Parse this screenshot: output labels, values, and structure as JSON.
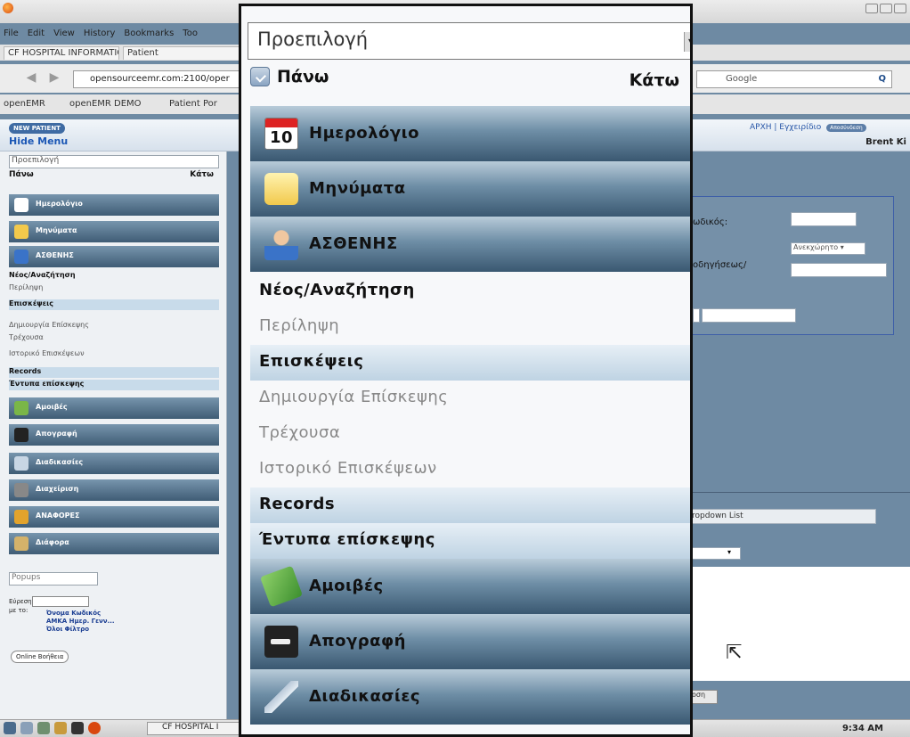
{
  "browser": {
    "menu": [
      "File",
      "Edit",
      "View",
      "History",
      "Bookmarks",
      "Too"
    ],
    "tabs": [
      "CF HOSPITAL INFORMATION... ✕",
      "Patient"
    ],
    "url": "opensourceemr.com:2100/oper",
    "search_placeholder": "Google",
    "bookmarks": [
      "openEMR",
      "openEMR DEMO",
      "Patient Por"
    ]
  },
  "header": {
    "new_patient": "NEW PATIENT",
    "hide_menu": "Hide Menu",
    "top_links": "ΑΡΧΗ | Εγχειρίδιο",
    "logout": "Αποσύνδεση",
    "user": "Brent Ki"
  },
  "left_small": {
    "select": "Προεπιλογή",
    "up": "Πάνω",
    "down": "Κάτω",
    "items": [
      {
        "type": "bar",
        "label": "Ημερολόγιο",
        "icon": "calendar-icon"
      },
      {
        "type": "bar",
        "label": "Μηνύματα",
        "icon": "mail-icon"
      },
      {
        "type": "bar",
        "label": "ΑΣΘΕΝΗΣ",
        "icon": "patient-icon"
      },
      {
        "type": "dark",
        "label": "Νέος/Αναζήτηση"
      },
      {
        "type": "text",
        "label": "Περίληψη"
      },
      {
        "type": "sec",
        "label": "Επισκέψεις"
      },
      {
        "type": "text",
        "label": "Δημιουργία Επίσκεψης"
      },
      {
        "type": "text",
        "label": "Τρέχουσα"
      },
      {
        "type": "text",
        "label": "Ιστορικό Επισκέψεων"
      },
      {
        "type": "sec",
        "label": "Records"
      },
      {
        "type": "sec",
        "label": "Έντυπα επίσκεψης"
      },
      {
        "type": "bar",
        "label": "Αμοιβές",
        "icon": "money-icon"
      },
      {
        "type": "bar",
        "label": "Απογραφή",
        "icon": "key-icon"
      },
      {
        "type": "bar",
        "label": "Διαδικασίες",
        "icon": "syringe-icon"
      },
      {
        "type": "bar",
        "label": "Διαχείριση",
        "icon": "admin-icon"
      },
      {
        "type": "bar",
        "label": "ΑΝΑΦΟΡΕΣ",
        "icon": "reports-icon"
      },
      {
        "type": "bar",
        "label": "Διάφορα",
        "icon": "misc-icon"
      }
    ],
    "popups": "Popups",
    "search_label": "Εύρεση:",
    "by_label": "με το:",
    "search_links": [
      "Όνομα   Κωδικός",
      "ΑΜΚΑ Ημερ. Γενν...",
      "Όλοι      Φίλτρο"
    ],
    "online_help": "Online Βοήθεια"
  },
  "form": {
    "code_label": "ωδικός:",
    "select_value": "Ανεκχώρητο",
    "instructions_label": "οδηγήσεως/",
    "dropdown_list": "ropdown List",
    "button_fragment": "οση"
  },
  "zoom": {
    "select": "Προεπιλογή",
    "up": "Πάνω",
    "down": "Κάτω",
    "calendar_num": "10",
    "items": [
      {
        "type": "bar",
        "label": "Ημερολόγιο",
        "icon": "calendar-icon"
      },
      {
        "type": "bar",
        "label": "Μηνύματα",
        "icon": "mail-icon"
      },
      {
        "type": "bar",
        "label": "ΑΣΘΕΝΗΣ",
        "icon": "patient-icon"
      },
      {
        "type": "dark",
        "label": "Νέος/Αναζήτηση"
      },
      {
        "type": "text",
        "label": "Περίληψη"
      },
      {
        "type": "sec",
        "label": "Επισκέψεις"
      },
      {
        "type": "text",
        "label": "Δημιουργία Επίσκεψης"
      },
      {
        "type": "text",
        "label": "Τρέχουσα"
      },
      {
        "type": "text",
        "label": "Ιστορικό Επισκέψεων"
      },
      {
        "type": "sec",
        "label": "Records"
      },
      {
        "type": "sec",
        "label": "Έντυπα επίσκεψης"
      },
      {
        "type": "bar",
        "label": "Αμοιβές",
        "icon": "money-icon"
      },
      {
        "type": "bar",
        "label": "Απογραφή",
        "icon": "key-icon"
      },
      {
        "type": "bar",
        "label": "Διαδικασίες",
        "icon": "syringe-icon"
      }
    ]
  },
  "taskbar": {
    "task": "CF HOSPITAL I",
    "clock": "9:34 AM"
  }
}
